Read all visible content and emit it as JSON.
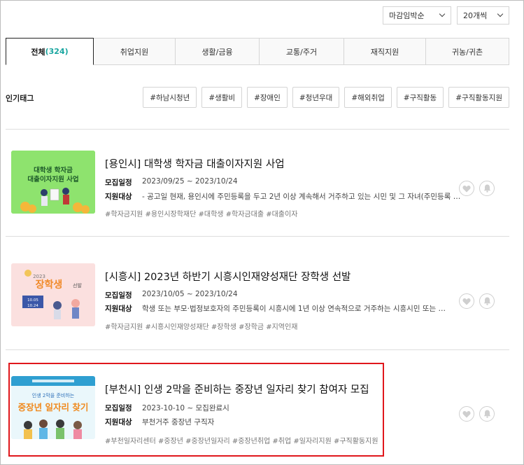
{
  "sort": {
    "order_label": "마감임박순",
    "per_page_label": "20개씩"
  },
  "tabs": [
    {
      "label": "전체",
      "count": "(324)",
      "active": true
    },
    {
      "label": "취업지원"
    },
    {
      "label": "생활/금융"
    },
    {
      "label": "교통/주거"
    },
    {
      "label": "재직지원"
    },
    {
      "label": "귀농/귀촌"
    }
  ],
  "popular_tags": {
    "title": "인기태그",
    "tags": [
      "#하남시청년",
      "#생활비",
      "#장애인",
      "#청년우대",
      "#해외취업",
      "#구직활동",
      "#구직활동지원"
    ]
  },
  "labels": {
    "schedule": "모집일정",
    "target": "지원대상"
  },
  "items": [
    {
      "title": "[용인시] 대학생 학자금 대출이자지원 사업",
      "schedule": "2023/09/25 ~ 2023/10/24",
      "target": "- 공고일 현재, 용인시에 주민등록을 두고 2년 이상 계속해서 거주하고 있는 시민 및 그 자녀(주민등록 …",
      "hashtags": "#학자금지원 #용인시장학재단 #대학생 #학자금대출 #대출이자",
      "thumb_text": [
        "대학생 학자금",
        "대출이자지원 사업"
      ]
    },
    {
      "title": "[시흥시] 2023년 하반기 시흥시인재양성재단 장학생 선발",
      "schedule": "2023/10/05 ~ 2023/10/24",
      "target": "학생 또는 부모·법정보호자의 주민등록이 시흥시에 1년 이상 연속적으로 거주하는 시흥시민 또는 …",
      "hashtags": "#학자금지원 #시흥시인재양성재단 #장학생 #장학금 #지역인재",
      "thumb_text": [
        "2023",
        "장학생",
        "선발",
        "10.05",
        "10.24"
      ]
    },
    {
      "title": "[부천시] 인생 2막을 준비하는 중장년 일자리 찾기 참여자 모집",
      "schedule": "2023-10-10 ~ 모집완료시",
      "target": "부천거주 중장년 구직자",
      "hashtags": "#부천일자리센터 #중장년 #중장년일자리 #중장년취업 #취업 #일자리지원 #구직활동지원",
      "thumb_text": [
        "인생 2막을 준비하는",
        "중장년 일자리 찾기"
      ]
    }
  ],
  "colors": {
    "accent_teal": "#1aa6a0",
    "highlight_red": "#e0171c"
  }
}
